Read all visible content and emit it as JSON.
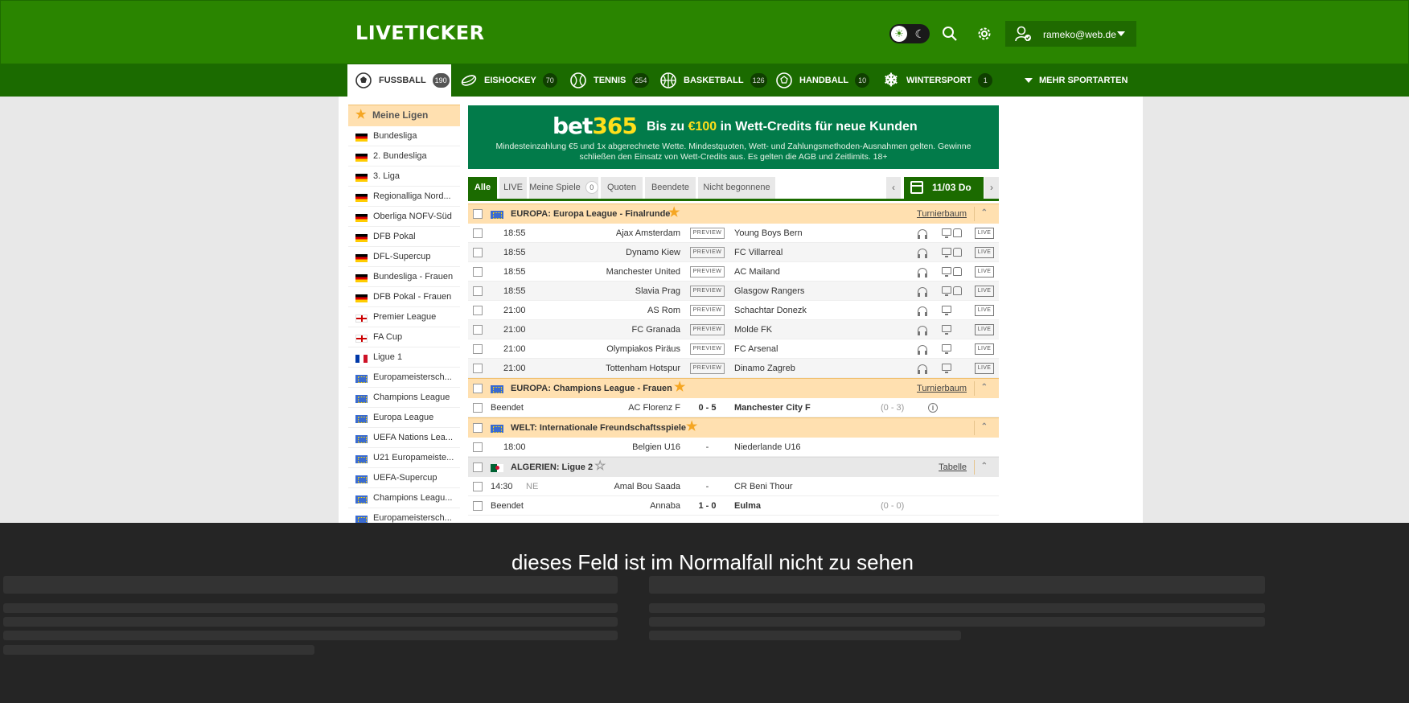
{
  "header": {
    "logo": "LIVETICKER",
    "user_email": "rameko@web.de"
  },
  "sports": [
    {
      "label": "FUSSBALL",
      "count": "190",
      "icon": "soccer-ball-icon"
    },
    {
      "label": "EISHOCKEY",
      "count": "70",
      "icon": "hockey-puck-icon"
    },
    {
      "label": "TENNIS",
      "count": "254",
      "icon": "tennis-ball-icon"
    },
    {
      "label": "BASKETBALL",
      "count": "126",
      "icon": "basketball-icon"
    },
    {
      "label": "HANDBALL",
      "count": "10",
      "icon": "handball-icon"
    },
    {
      "label": "WINTERSPORT",
      "count": "1",
      "icon": "snowflake-icon"
    }
  ],
  "more_sports": "MEHR SPORTARTEN",
  "sidebar": {
    "title": "Meine Ligen",
    "items": [
      {
        "label": "Bundesliga",
        "flag": "de"
      },
      {
        "label": "2. Bundesliga",
        "flag": "de"
      },
      {
        "label": "3. Liga",
        "flag": "de"
      },
      {
        "label": "Regionalliga Nord...",
        "flag": "de"
      },
      {
        "label": "Oberliga NOFV-Süd",
        "flag": "de"
      },
      {
        "label": "DFB Pokal",
        "flag": "de"
      },
      {
        "label": "DFL-Supercup",
        "flag": "de"
      },
      {
        "label": "Bundesliga - Frauen",
        "flag": "de"
      },
      {
        "label": "DFB Pokal - Frauen",
        "flag": "de"
      },
      {
        "label": "Premier League",
        "flag": "en"
      },
      {
        "label": "FA Cup",
        "flag": "en"
      },
      {
        "label": "Ligue 1",
        "flag": "fr"
      },
      {
        "label": "Europameistersch...",
        "flag": "eu"
      },
      {
        "label": "Champions League",
        "flag": "eu"
      },
      {
        "label": "Europa League",
        "flag": "eu"
      },
      {
        "label": "UEFA Nations Lea...",
        "flag": "eu"
      },
      {
        "label": "U21 Europameiste...",
        "flag": "eu"
      },
      {
        "label": "UEFA-Supercup",
        "flag": "eu"
      },
      {
        "label": "Champions Leagu...",
        "flag": "eu"
      },
      {
        "label": "Europameistersch...",
        "flag": "eu"
      }
    ]
  },
  "banner": {
    "brand_a": "bet",
    "brand_b": "365",
    "head_a": "Bis zu ",
    "head_amount": "€100",
    "head_b": " in Wett-Credits für neue Kunden",
    "small": "Mindesteinzahlung €5 und 1x abgerechnete Wette. Mindestquoten, Wett- und Zahlungsmethoden-Ausnahmen gelten. Gewinne schließen den Einsatz von Wett-Credits aus. Es gelten die AGB und Zeitlimits. 18+"
  },
  "tabs": {
    "alle": "Alle",
    "live": "LIVE",
    "meine_spiele": "Meine Spiele",
    "meine_spiele_count": "0",
    "quoten": "Quoten",
    "beendete": "Beendete",
    "nicht_begonnene": "Nicht begonnene",
    "prev_arrow": "‹",
    "next_arrow": "›",
    "date": "11/03 Do"
  },
  "labels": {
    "preview": "PREVIEW",
    "live": "LIVE",
    "turnierbaum": "Turnierbaum",
    "tabelle": "Tabelle",
    "collapse": "^"
  },
  "groups": [
    {
      "title": "EUROPA: Europa League - Finalrunde",
      "starred": true,
      "link": "Turnierbaum",
      "flag": "eu",
      "matches": [
        {
          "time": "18:55",
          "home": "Ajax Amsterdam",
          "away": "Young Boys Bern"
        },
        {
          "time": "18:55",
          "home": "Dynamo Kiew",
          "away": "FC Villarreal"
        },
        {
          "time": "18:55",
          "home": "Manchester United",
          "away": "AC Mailand"
        },
        {
          "time": "18:55",
          "home": "Slavia Prag",
          "away": "Glasgow Rangers"
        },
        {
          "time": "21:00",
          "home": "AS Rom",
          "away": "Schachtar Donezk"
        },
        {
          "time": "21:00",
          "home": "FC Granada",
          "away": "Molde FK"
        },
        {
          "time": "21:00",
          "home": "Olympiakos Piräus",
          "away": "FC Arsenal"
        },
        {
          "time": "21:00",
          "home": "Tottenham Hotspur",
          "away": "Dinamo Zagreb"
        }
      ]
    },
    {
      "title": "EUROPA: Champions League - Frauen",
      "starred": true,
      "link": "Turnierbaum",
      "flag": "eu",
      "matches": [
        {
          "status": "Beendet",
          "home": "AC Florenz F",
          "score": "0 - 5",
          "away": "Manchester City F",
          "half": "(0 - 3)"
        }
      ]
    },
    {
      "title": "WELT: Internationale Freundschaftsspiele",
      "starred": true,
      "flag": "eu",
      "matches": [
        {
          "time": "18:00",
          "home": "Belgien U16",
          "score": "-",
          "away": "Niederlande U16"
        }
      ]
    },
    {
      "title": "ALGERIEN: Ligue 2",
      "starred": false,
      "link": "Tabelle",
      "flag": "dz",
      "matches": [
        {
          "time": "14:30",
          "ne": "NE",
          "home": "Amal Bou Saada",
          "score": "-",
          "away": "CR Beni Thour"
        },
        {
          "status": "Beendet",
          "home": "Annaba",
          "score": "1 - 0",
          "away": "Eulma",
          "half": "(0 - 0)"
        }
      ]
    }
  ],
  "overlay": {
    "message": "dieses Feld ist im Normalfall nicht zu sehen"
  },
  "colors": {
    "brand_green": "#2a8500",
    "nav_green": "#1b6b00",
    "bet365_green": "#027b4a",
    "bet365_yellow": "#ffdf1b",
    "league_highlight": "#ffe0b0",
    "star": "#f5a623"
  }
}
